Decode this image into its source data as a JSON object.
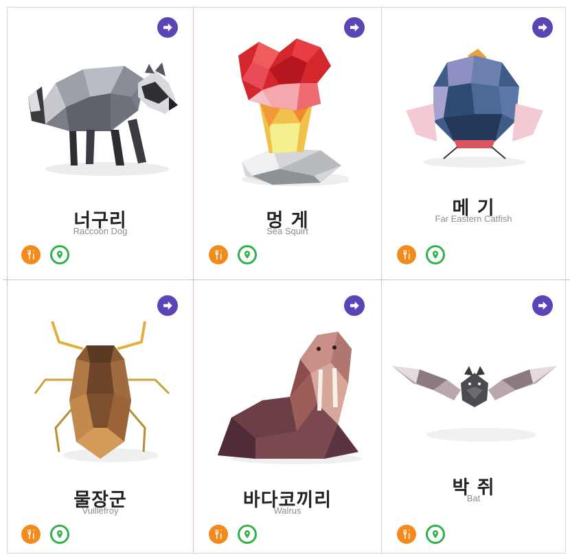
{
  "cards": [
    {
      "name_ko": "너구리",
      "name_en": "Raccoon Dog"
    },
    {
      "name_ko": "멍 게",
      "name_en": "Sea Squirt"
    },
    {
      "name_ko": "메 기",
      "name_en": "Far Eastern Catfish"
    },
    {
      "name_ko": "물장군",
      "name_en": "Vuillefroy"
    },
    {
      "name_ko": "바다코끼리",
      "name_en": "Walrus"
    },
    {
      "name_ko": "박 쥐",
      "name_en": "Bat"
    }
  ],
  "icons": {
    "next": "arrow-right-icon",
    "food": "fork-knife-icon",
    "habitat": "map-pin-icon"
  },
  "colors": {
    "next_button": "#5a44b6",
    "food_button": "#f28a1c",
    "habitat_button": "#2fb24a"
  }
}
